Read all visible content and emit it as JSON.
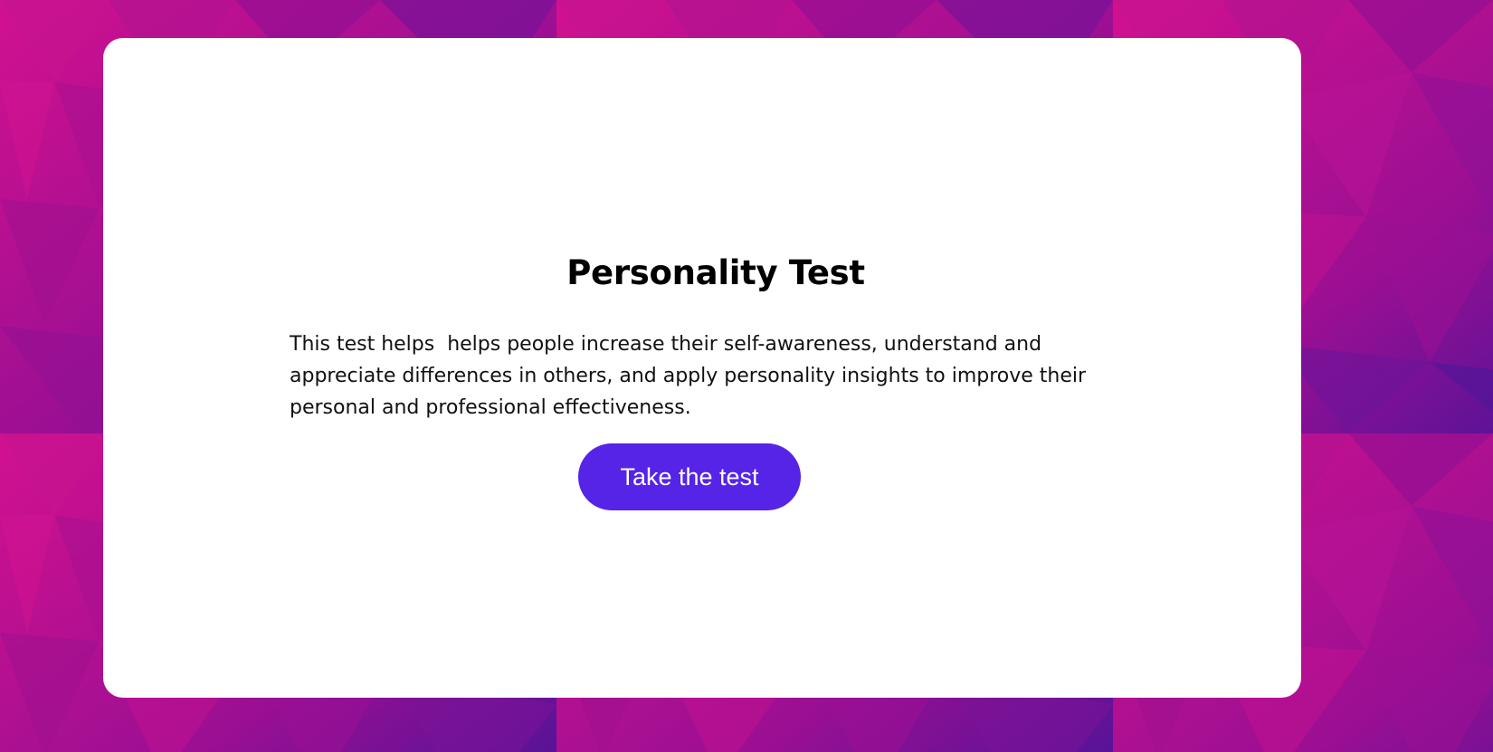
{
  "page": {
    "title": "Personality Test",
    "description": "This test helps  helps people increase their self-awareness, understand and appreciate differences in others, and apply personality insights to improve their personal and professional effectiveness.",
    "cta_label": "Take the test"
  },
  "colors": {
    "background_magenta": "#d2118f",
    "background_purple": "#4a1496",
    "card": "#ffffff",
    "button": "#5524e6",
    "button_text": "#ffffff",
    "text": "#000000"
  }
}
